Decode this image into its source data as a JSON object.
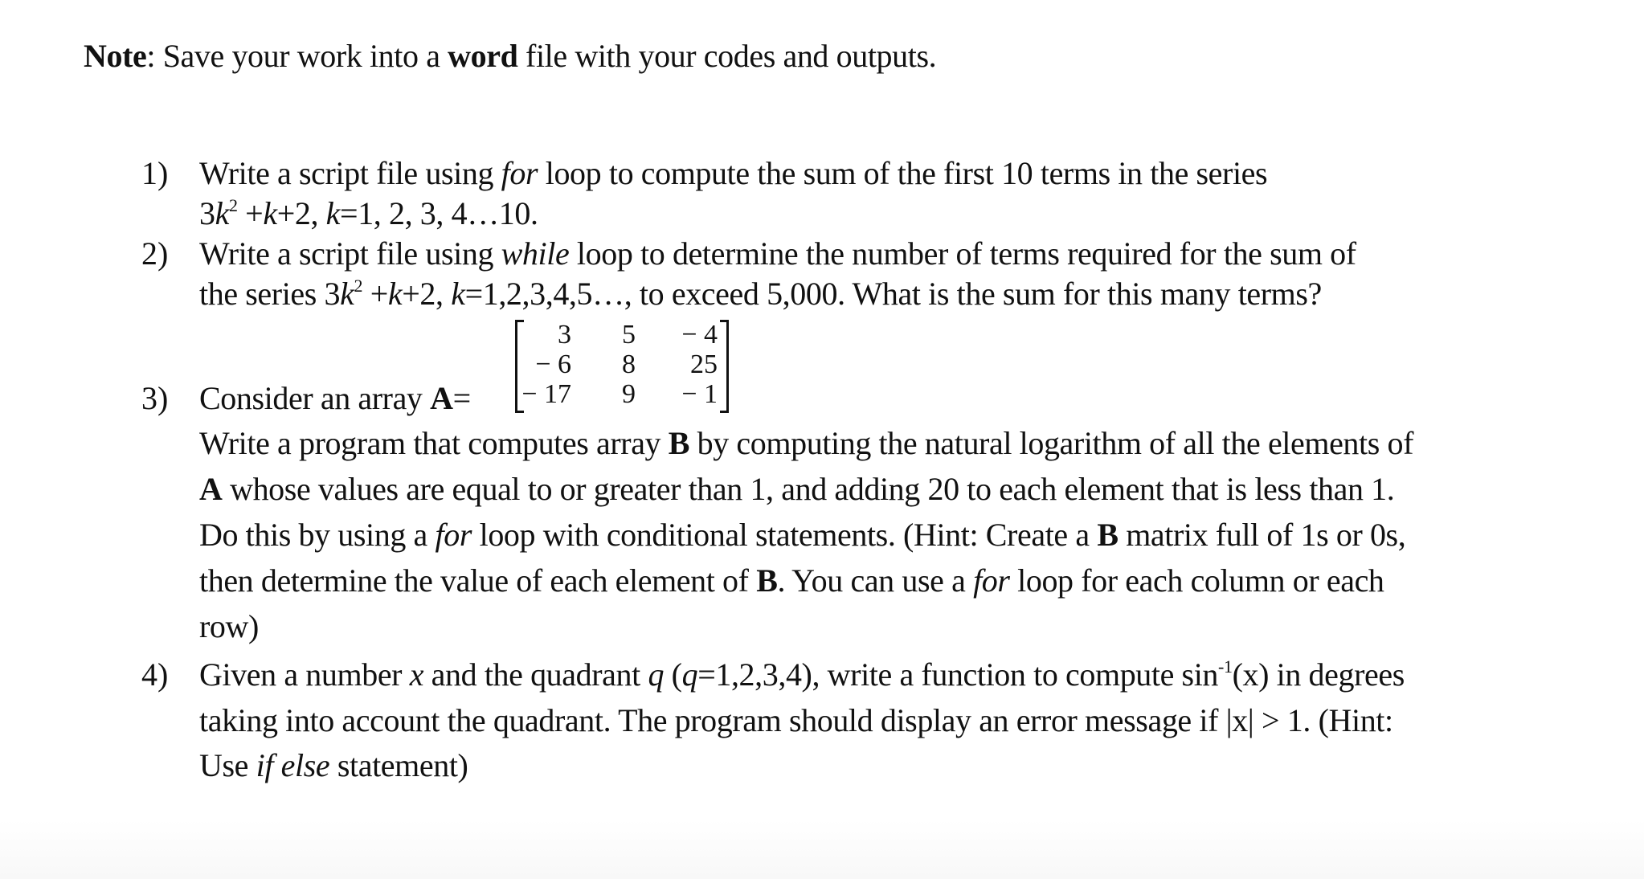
{
  "note": {
    "label": "Note",
    "text_before": ": Save your work into a ",
    "bold_word": "word",
    "text_after": " file with your codes and outputs."
  },
  "questions": [
    {
      "number": "1)",
      "lines": [
        {
          "a": "Write a script file using ",
          "i": "for",
          "b": " loop to compute the sum of the first 10 terms in the series"
        },
        {
          "a": "3",
          "i": "k",
          "sup": "2",
          "b": " +",
          "i2": "k",
          "c": "+2, ",
          "i3": "k",
          "d": "=1, 2, 3, 4…10."
        }
      ]
    },
    {
      "number": "2)",
      "lines": [
        {
          "a": "Write a script file using ",
          "i": "while",
          "b": " loop to determine the number of terms required for the sum of"
        },
        {
          "a": "the series 3",
          "i": "k",
          "sup": "2",
          "b": " +",
          "i2": "k",
          "c": "+2, ",
          "i3": "k",
          "d": "=1,2,3,4,5…, to exceed 5,000. What is the sum for this many terms?"
        }
      ]
    },
    {
      "number": "3)",
      "intro": "Consider an array ",
      "array_name": "A",
      "equals": "=",
      "matrix": [
        [
          "3",
          "5",
          "− 4"
        ],
        [
          "− 6",
          "8",
          "25"
        ],
        [
          "− 17",
          "9",
          "− 1"
        ]
      ],
      "lines": [
        {
          "a": "Write a program that computes array ",
          "b1": "B",
          "b": " by computing the natural logarithm of all the elements of"
        },
        {
          "b1": "A",
          "a": " whose values are equal to or greater than 1, and adding 20 to each element that is less than 1."
        },
        {
          "a": "Do this by using a ",
          "i": "for",
          "b": " loop with conditional statements. (Hint: Create a ",
          "b1": "B",
          "c": " matrix full of 1s or 0s,"
        },
        {
          "a": "then determine the value of each element of ",
          "b1": "B",
          "b": ". You can use a ",
          "i": "for",
          "c": " loop for each column or each"
        },
        {
          "a": "row)"
        }
      ]
    },
    {
      "number": "4)",
      "lines": [
        {
          "a": "Given a number ",
          "i": "x",
          "b": " and the quadrant ",
          "i2": "q",
          "c": " (",
          "i3": "q",
          "d": "=1,2,3,4), write a function to compute sin",
          "sup": "-1",
          "e": "(x) in degrees"
        },
        {
          "a": "taking into account the quadrant. The program should display an error message if |x| > 1. (Hint:"
        },
        {
          "a": "Use ",
          "i": "if",
          "b": " ",
          "i2": "else",
          "c": " statement)"
        }
      ]
    }
  ]
}
